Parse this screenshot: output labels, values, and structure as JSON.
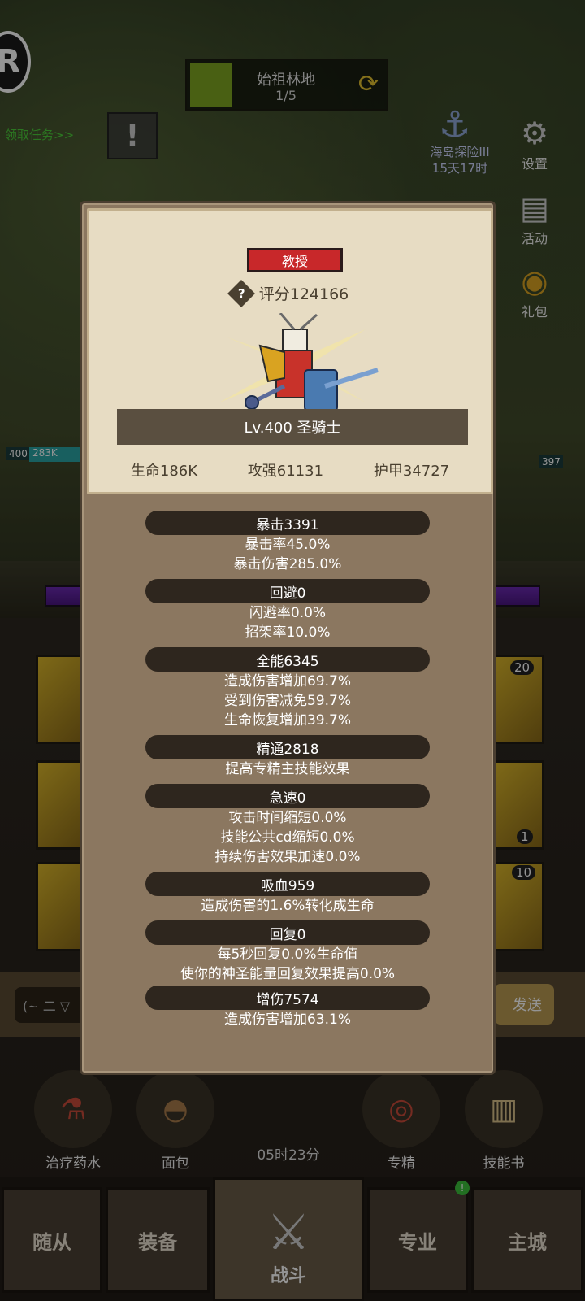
{
  "background": {
    "zone": {
      "name": "始祖林地",
      "progress": "1/5"
    },
    "quest_link": "领取任务>>",
    "island": {
      "line1": "海岛探险III",
      "line2": "15天17时"
    },
    "side_menu": [
      {
        "label": "设置",
        "icon": "gear-icon"
      },
      {
        "label": "活动",
        "icon": "scroll-icon"
      },
      {
        "label": "礼包",
        "icon": "gift-icon"
      }
    ],
    "hp_left_level": "400",
    "hp_left_value": "283K",
    "hp_right_level": "397",
    "tile_counts": [
      "20",
      "1",
      "10"
    ],
    "chat_placeholder": "(~ 二 ▽",
    "chat_send": "发送",
    "consumables": [
      {
        "label": "治疗药水",
        "icon": "potion-icon"
      },
      {
        "label": "面包",
        "icon": "bread-icon"
      },
      {
        "label": "专精",
        "icon": "mastery-icon"
      },
      {
        "label": "技能书",
        "icon": "skillbook-icon"
      }
    ],
    "timer": "05时23分",
    "nav": {
      "followers": "随从",
      "equipment": "装备",
      "battle": "战斗",
      "profession": "专业",
      "main_city": "主城"
    },
    "colors": {
      "xp_bar": "#6a2ab0",
      "quest_text": "#4bcc3a",
      "zone_thumb": "#7ea521"
    }
  },
  "modal": {
    "title": "教授",
    "score": "评分124166",
    "class_line": "Lv.400 圣骑士",
    "stats": {
      "hp": "生命186K",
      "attack": "攻强61131",
      "armor": "护甲34727"
    },
    "attributes": [
      {
        "header": "暴击3391",
        "lines": [
          "暴击率45.0%",
          "暴击伤害285.0%"
        ]
      },
      {
        "header": "回避0",
        "lines": [
          "闪避率0.0%",
          "招架率10.0%"
        ]
      },
      {
        "header": "全能6345",
        "lines": [
          "造成伤害增加69.7%",
          "受到伤害减免59.7%",
          "生命恢复增加39.7%"
        ]
      },
      {
        "header": "精通2818",
        "lines": [
          "提高专精主技能效果"
        ]
      },
      {
        "header": "急速0",
        "lines": [
          "攻击时间缩短0.0%",
          "技能公共cd缩短0.0%",
          "持续伤害效果加速0.0%"
        ]
      },
      {
        "header": "吸血959",
        "lines": [
          "造成伤害的1.6%转化成生命"
        ]
      },
      {
        "header": "回复0",
        "lines": [
          "每5秒回复0.0%生命值",
          "使你的神圣能量回复效果提高0.0%"
        ]
      },
      {
        "header": "增伤7574",
        "lines": [
          "造成伤害增加63.1%"
        ]
      }
    ],
    "colors": {
      "title_badge": "#c8282a",
      "panel": "#8b7760",
      "head_panel": "#e7dcc3"
    }
  }
}
